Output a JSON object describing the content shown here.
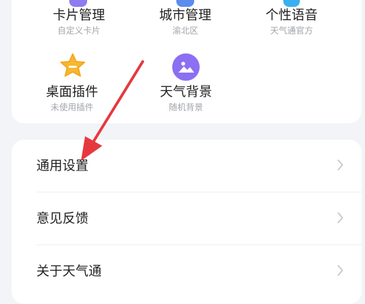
{
  "grid": {
    "items": [
      {
        "title": "卡片管理",
        "sub": "自定义卡片"
      },
      {
        "title": "城市管理",
        "sub": "渝北区"
      },
      {
        "title": "个性语音",
        "sub": "天气通官方"
      },
      {
        "title": "桌面插件",
        "sub": "未使用插件",
        "icon": "star-widget-icon",
        "color": "#f7b733"
      },
      {
        "title": "天气背景",
        "sub": "随机背景",
        "icon": "landscape-image-icon",
        "color": "#8c6ff2"
      }
    ]
  },
  "settings": {
    "items": [
      {
        "label": "通用设置"
      },
      {
        "label": "意见反馈"
      },
      {
        "label": "关于天气通"
      }
    ]
  },
  "annotation": {
    "arrow_color": "#e6393f"
  }
}
